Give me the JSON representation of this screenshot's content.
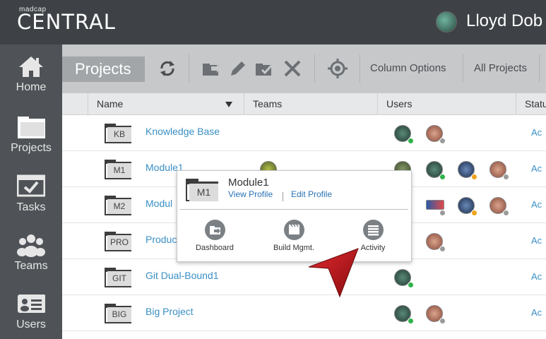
{
  "header": {
    "brand_small": "madcap",
    "brand_big": "CENTRAL",
    "user_name": "Lloyd Dob"
  },
  "sidebar": {
    "items": [
      {
        "label": "Home",
        "icon": "home-icon"
      },
      {
        "label": "Projects",
        "icon": "projects-folder-icon"
      },
      {
        "label": "Tasks",
        "icon": "tasks-icon"
      },
      {
        "label": "Teams",
        "icon": "teams-icon"
      },
      {
        "label": "Users",
        "icon": "users-icon"
      }
    ]
  },
  "toolbar": {
    "section_label": "Projects",
    "column_options": "Column Options",
    "filter_label": "All Projects",
    "icons": [
      "refresh-icon",
      "open-folder-icon",
      "edit-pencil-icon",
      "checkout-folder-icon",
      "delete-x-icon",
      "locate-target-icon"
    ]
  },
  "table": {
    "columns": [
      "Name",
      "Teams",
      "Users",
      "Statu"
    ],
    "rows": [
      {
        "badge": "KB",
        "name": "Knowledge Base",
        "status": "Ac"
      },
      {
        "badge": "M1",
        "name": "Module1",
        "status": "Ac"
      },
      {
        "badge": "M2",
        "name": "Modul",
        "status": "Ac"
      },
      {
        "badge": "PRO",
        "name": "Produc",
        "status": "Ac"
      },
      {
        "badge": "GIT",
        "name": "Git Dual-Bound1",
        "status": "Ac"
      },
      {
        "badge": "BIG",
        "name": "Big Project",
        "status": "Ac"
      }
    ]
  },
  "popup": {
    "badge": "M1",
    "title": "Module1",
    "view_profile": "View Profile",
    "edit_profile": "Edit Profile",
    "actions": [
      {
        "label": "Dashboard",
        "icon": "dashboard-icon"
      },
      {
        "label": "Build Mgmt.",
        "icon": "build-clapper-icon"
      },
      {
        "label": "Activity",
        "icon": "activity-list-icon"
      }
    ]
  },
  "colors": {
    "topbar": "#3e4246",
    "sidebar": "#4f5357",
    "toolbar": "#c6c8ca",
    "link": "#3a8fc6",
    "online": "#2fb34a",
    "away": "#f0a41c",
    "offline": "#9a9a9a",
    "callout_arrow": "#c0141b"
  }
}
